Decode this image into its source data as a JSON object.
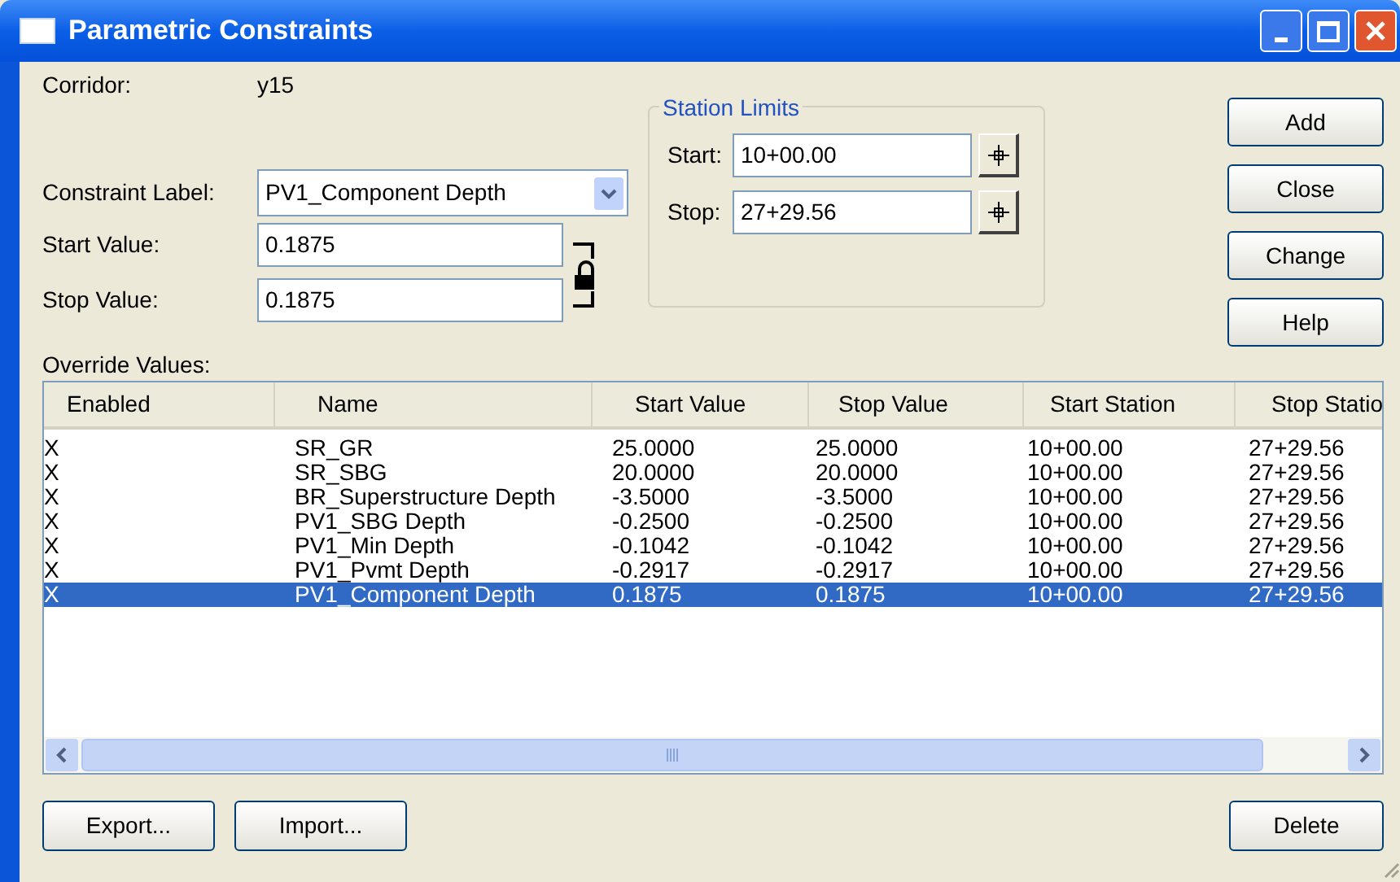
{
  "window": {
    "title": "Parametric Constraints"
  },
  "corridor": {
    "label": "Corridor:",
    "value": "y15"
  },
  "constraint_label": {
    "label": "Constraint Label:",
    "value": "PV1_Component Depth"
  },
  "start_value": {
    "label": "Start Value:",
    "value": "0.1875"
  },
  "stop_value": {
    "label": "Stop Value:",
    "value": "0.1875"
  },
  "station_limits": {
    "title": "Station Limits",
    "start": {
      "label": "Start:",
      "value": "10+00.00"
    },
    "stop": {
      "label": "Stop:",
      "value": "27+29.56"
    }
  },
  "side_buttons": [
    "Add",
    "Close",
    "Change",
    "Help"
  ],
  "override_values": {
    "label": "Override Values:",
    "columns": [
      "Enabled",
      "Name",
      "Start Value",
      "Stop Value",
      "Start Station",
      "Stop Statio"
    ],
    "rows": [
      {
        "cells": [
          "X",
          "SR_GR",
          "25.0000",
          "25.0000",
          "10+00.00",
          "27+29.56"
        ],
        "selected": false
      },
      {
        "cells": [
          "X",
          "SR_SBG",
          "20.0000",
          "20.0000",
          "10+00.00",
          "27+29.56"
        ],
        "selected": false
      },
      {
        "cells": [
          "X",
          "BR_Superstructure Depth",
          "-3.5000",
          "-3.5000",
          "10+00.00",
          "27+29.56"
        ],
        "selected": false
      },
      {
        "cells": [
          "X",
          "PV1_SBG Depth",
          "-0.2500",
          "-0.2500",
          "10+00.00",
          "27+29.56"
        ],
        "selected": false
      },
      {
        "cells": [
          "X",
          "PV1_Min Depth",
          "-0.1042",
          "-0.1042",
          "10+00.00",
          "27+29.56"
        ],
        "selected": false
      },
      {
        "cells": [
          "X",
          "PV1_Pvmt Depth",
          "-0.2917",
          "-0.2917",
          "10+00.00",
          "27+29.56"
        ],
        "selected": false
      },
      {
        "cells": [
          "X",
          "PV1_Component Depth",
          "0.1875",
          "0.1875",
          "10+00.00",
          "27+29.56"
        ],
        "selected": true
      }
    ]
  },
  "bottom_buttons": [
    "Export...",
    "Import..."
  ],
  "delete_button": "Delete"
}
